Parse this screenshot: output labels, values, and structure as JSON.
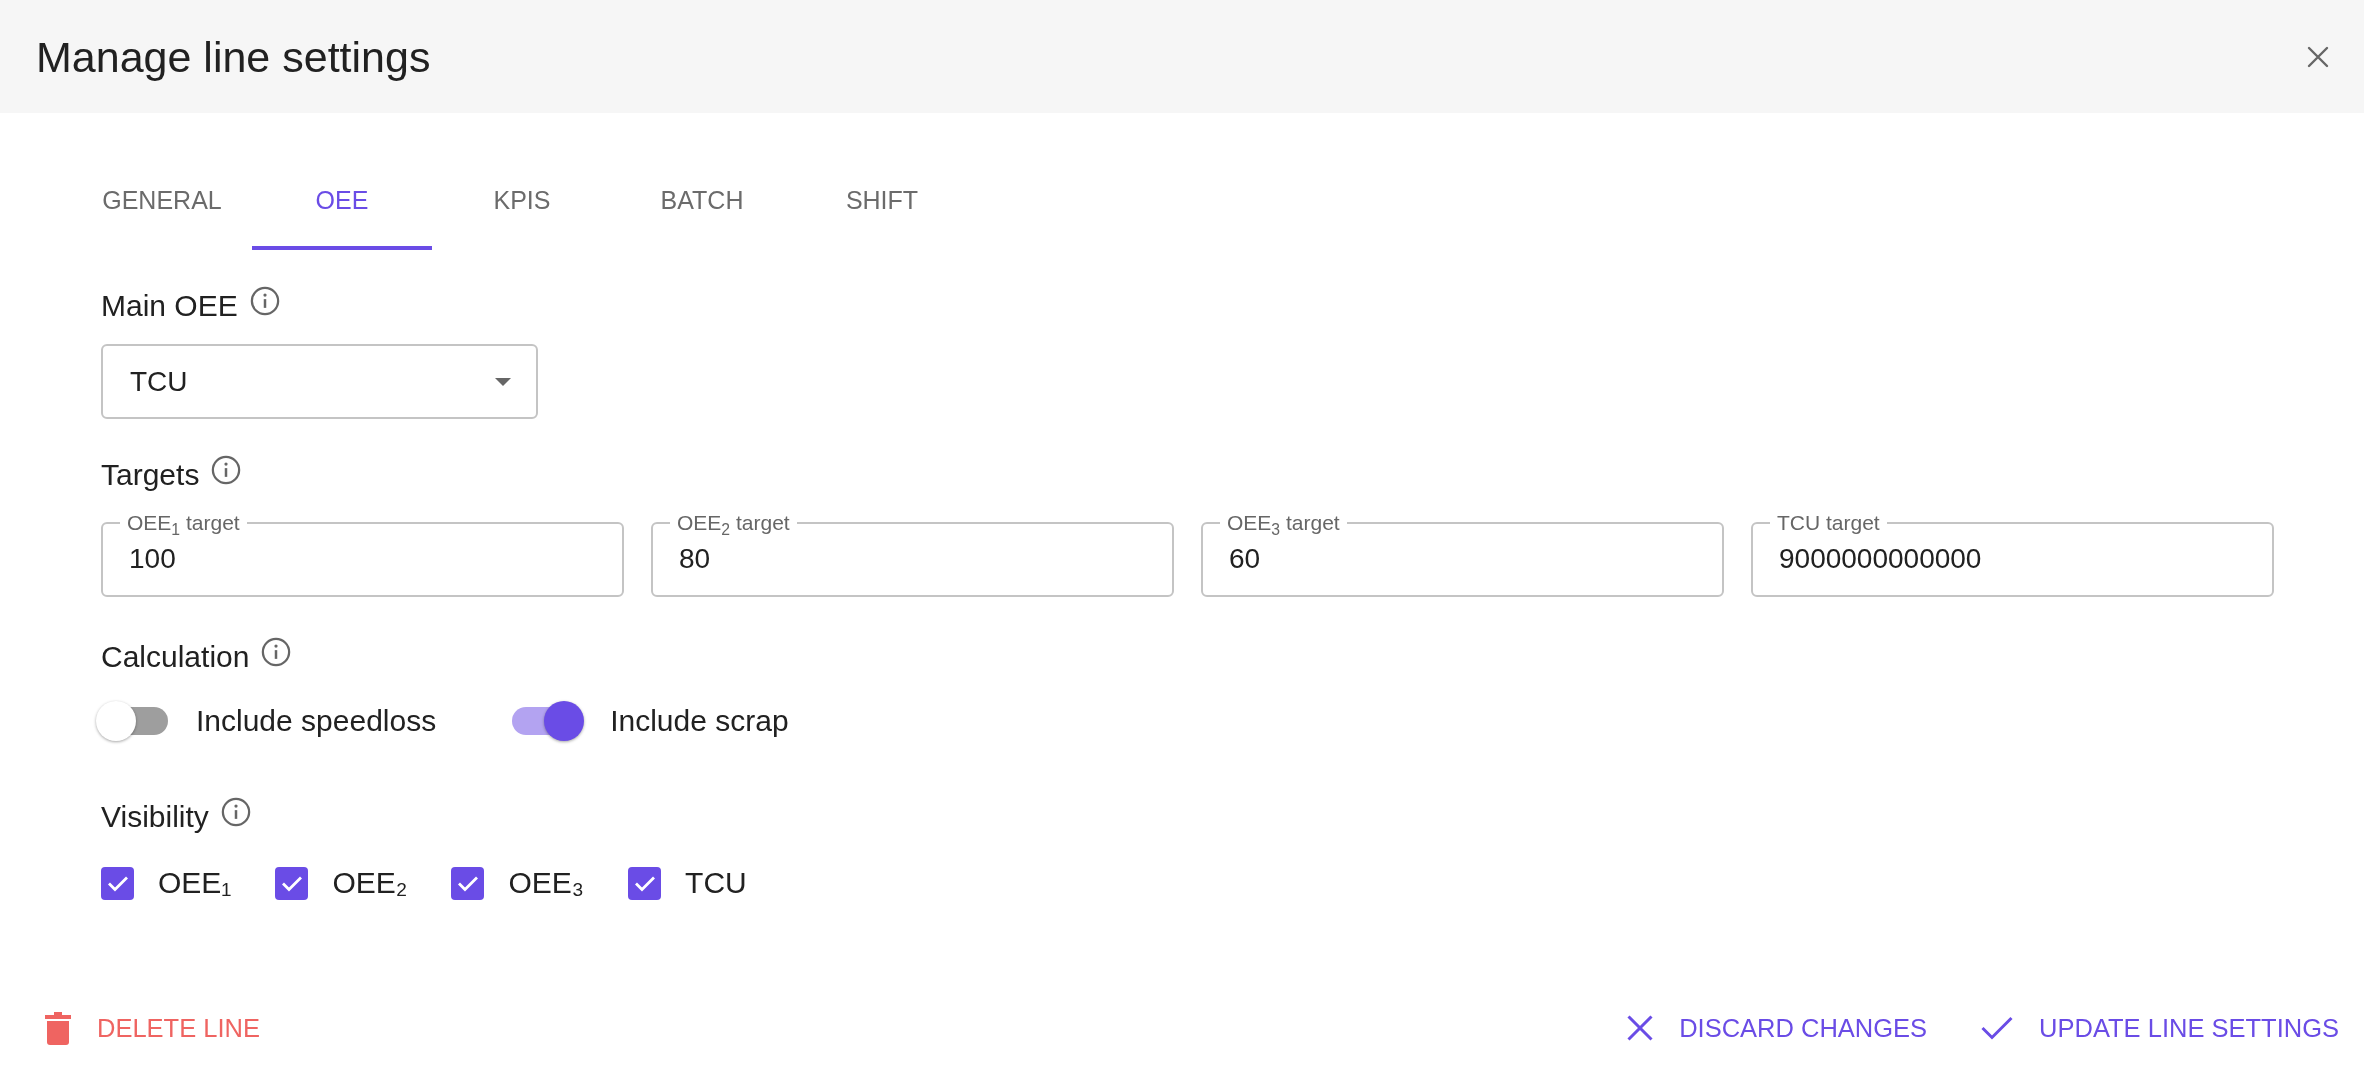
{
  "dialog": {
    "title": "Manage line settings"
  },
  "tabs": [
    {
      "label": "GENERAL",
      "selected": false
    },
    {
      "label": "OEE",
      "selected": true
    },
    {
      "label": "KPIS",
      "selected": false
    },
    {
      "label": "BATCH",
      "selected": false
    },
    {
      "label": "SHIFT",
      "selected": false
    }
  ],
  "main_oee": {
    "label": "Main OEE",
    "select": {
      "value": "TCU"
    }
  },
  "targets": {
    "label": "Targets",
    "fields": [
      {
        "label": "OEE$_{1}$ target",
        "value": "100"
      },
      {
        "label": "OEE$_{2}$ target",
        "value": "80"
      },
      {
        "label": "OEE$_{3}$ target",
        "value": "60"
      },
      {
        "label": "TCU target",
        "value": "9000000000000"
      }
    ]
  },
  "calculation": {
    "label": "Calculation",
    "toggles": [
      {
        "label": "Include speedloss",
        "on": false
      },
      {
        "label": "Include scrap",
        "on": true
      }
    ]
  },
  "visibility": {
    "label": "Visibility",
    "checkboxes": [
      {
        "label": "OEE₁",
        "checked": true
      },
      {
        "label": "OEE₂",
        "checked": true
      },
      {
        "label": "OEE₃",
        "checked": true
      },
      {
        "label": "TCU",
        "checked": true
      }
    ]
  },
  "footer": {
    "buttons": [
      {
        "kind": "delete",
        "label": "DELETE LINE"
      },
      {
        "kind": "discard",
        "label": "DISCARD CHANGES"
      },
      {
        "kind": "update",
        "label": "UPDATE LINE SETTINGS"
      }
    ]
  }
}
